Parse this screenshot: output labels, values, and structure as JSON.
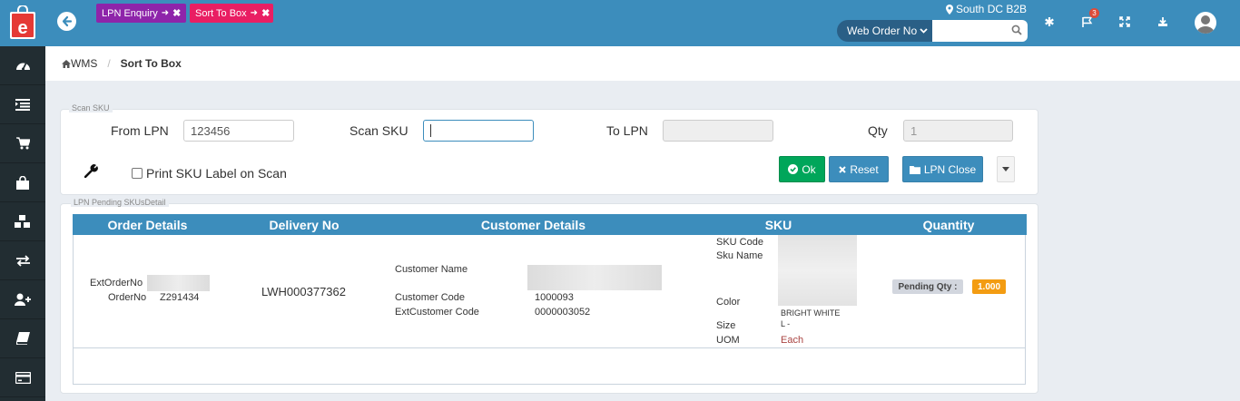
{
  "topbar": {
    "tabs": [
      {
        "label": "LPN Enquiry"
      },
      {
        "label": "Sort To Box"
      }
    ],
    "location": "South DC B2B",
    "search": {
      "select_label": "Web Order No",
      "value": ""
    },
    "notification_count": "3",
    "icons": [
      "back-icon",
      "map-marker-icon",
      "search-icon",
      "asterisk-icon",
      "flag-icon",
      "expand-icon",
      "download-icon",
      "user-avatar-icon"
    ]
  },
  "sidebar": {
    "items": [
      {
        "icon": "dashboard-icon"
      },
      {
        "icon": "list-icon"
      },
      {
        "icon": "cart-icon"
      },
      {
        "icon": "shopping-bag-icon"
      },
      {
        "icon": "cubes-icon"
      },
      {
        "icon": "exchange-icon"
      },
      {
        "icon": "user-plus-icon"
      },
      {
        "icon": "book-icon"
      },
      {
        "icon": "credit-card-icon"
      }
    ]
  },
  "breadcrumb": {
    "root": "WMS",
    "current": "Sort To Box"
  },
  "scan": {
    "legend": "Scan SKU",
    "from_lpn_label": "From LPN",
    "from_lpn_value": "123456",
    "scan_sku_label": "Scan SKU",
    "scan_sku_value": "",
    "to_lpn_label": "To LPN",
    "to_lpn_value": "",
    "qty_label": "Qty",
    "qty_value": "1",
    "print_label": "Print SKU Label on Scan",
    "print_checked": false,
    "ok_label": "Ok",
    "reset_label": "Reset",
    "close_label": "LPN Close"
  },
  "detail": {
    "legend": "LPN Pending SKUsDetail",
    "headers": [
      "Order Details",
      "Delivery No",
      "Customer Details",
      "SKU",
      "Quantity"
    ],
    "ext_order_no_label": "ExtOrderNo",
    "order_no_label": "OrderNo",
    "order_no": "Z291434",
    "delivery_no": "LWH000377362",
    "customer_name_label": "Customer Name",
    "customer_code_label": "Customer Code",
    "customer_code": "1000093",
    "ext_customer_code_label": "ExtCustomer Code",
    "ext_customer_code": "0000003052",
    "sku_code_label": "SKU Code",
    "sku_name_label": "Sku Name",
    "color_label": "Color",
    "color_value": "BRIGHT WHITE",
    "size_label": "Size",
    "size_value": "L -",
    "uom_label": "UOM",
    "uom_value": "Each",
    "pending_label": "Pending Qty :",
    "pending_value": "1.000"
  }
}
